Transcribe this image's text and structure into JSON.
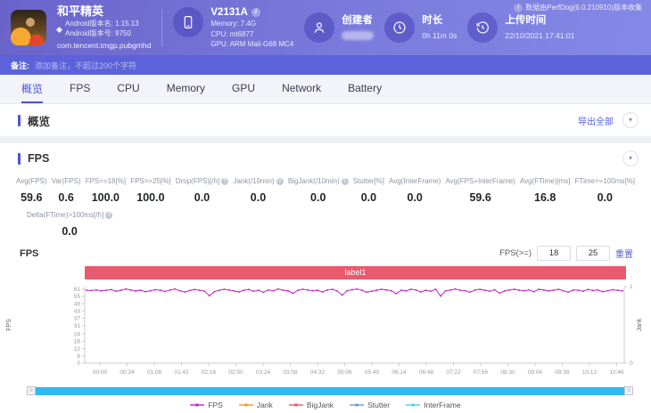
{
  "header": {
    "app": {
      "name": "和平精英",
      "version_name": "Android版本名: 1.15.13",
      "version_code": "Android版本号: 9750",
      "package": "com.tencent.tmgp.pubgmhd"
    },
    "device": {
      "model": "V2131A",
      "memory": "Memory: 7.4G",
      "cpu": "CPU: mt6877",
      "gpu": "GPU: ARM Mali-G68 MC4"
    },
    "creator": {
      "label": "创建者"
    },
    "duration": {
      "label": "时长",
      "value": "0h 11m 0s"
    },
    "upload": {
      "label": "上传时间",
      "value": "22/10/2021 17:41:01"
    },
    "collected_by": "数据由PerfDog(6.0.210910)版本收集"
  },
  "note_bar": {
    "label": "备注:",
    "placeholder": "添加备注，不超过200个字符"
  },
  "tabs": [
    {
      "label": "概览",
      "key": "overview"
    },
    {
      "label": "FPS",
      "key": "fps"
    },
    {
      "label": "CPU",
      "key": "cpu"
    },
    {
      "label": "Memory",
      "key": "memory"
    },
    {
      "label": "GPU",
      "key": "gpu"
    },
    {
      "label": "Network",
      "key": "network"
    },
    {
      "label": "Battery",
      "key": "battery"
    }
  ],
  "active_tab": "概览",
  "overview": {
    "title": "概览",
    "export_all": "导出全部"
  },
  "fps_section": {
    "title": "FPS",
    "stats": [
      {
        "label": "Avg(FPS)",
        "value": "59.6",
        "info": false
      },
      {
        "label": "Var(FPS)",
        "value": "0.6",
        "info": false
      },
      {
        "label": "FPS>=18[%]",
        "value": "100.0",
        "info": false
      },
      {
        "label": "FPS>=25[%]",
        "value": "100.0",
        "info": false
      },
      {
        "label": "Drop(FPS)[/h]",
        "value": "0.0",
        "info": true
      },
      {
        "label": "Jank(/10min)",
        "value": "0.0",
        "info": true
      },
      {
        "label": "BigJank(/10min)",
        "value": "0.0",
        "info": true
      },
      {
        "label": "Stutter[%]",
        "value": "0.0",
        "info": false
      },
      {
        "label": "Avg(InterFrame)",
        "value": "0.0",
        "info": false
      },
      {
        "label": "Avg(FPS+InterFrame)",
        "value": "59.6",
        "info": false
      },
      {
        "label": "Avg(FTime)[ms]",
        "value": "16.8",
        "info": false
      },
      {
        "label": "FTime>=100ms[%]",
        "value": "0.0",
        "info": false
      }
    ],
    "stats_row2": [
      {
        "label": "Delta(FTime)>100ms[/h]",
        "value": "0.0",
        "info": true
      }
    ],
    "chart_title": "FPS",
    "fps_threshold": {
      "label": "FPS(>=)",
      "low": "18",
      "high": "25",
      "reset": "重置"
    },
    "banner_label": "label1"
  },
  "chart_data": {
    "type": "line",
    "title": "FPS",
    "ylabel": "FPS",
    "y2label": "Jank",
    "ylim": [
      0,
      63
    ],
    "y2lim": [
      0,
      1
    ],
    "yticks": [
      61,
      55,
      49,
      43,
      37,
      31,
      24,
      18,
      12,
      6,
      0
    ],
    "y2ticks": [
      1,
      0
    ],
    "xticks": [
      "00:00",
      "00:34",
      "01:08",
      "01:42",
      "02:16",
      "02:50",
      "03:24",
      "03:58",
      "04:32",
      "05:06",
      "05:40",
      "06:14",
      "06:48",
      "07:22",
      "07:56",
      "08:30",
      "09:04",
      "09:38",
      "10:12",
      "10:46"
    ],
    "grid": false,
    "legend_position": "bottom",
    "series": [
      {
        "name": "FPS",
        "color": "#c522c9",
        "values": [
          60,
          59.8,
          60.2,
          59.5,
          60,
          60.5,
          59.2,
          60,
          61,
          60.2,
          59.4,
          60,
          58.8,
          59.6,
          60.4,
          60,
          59,
          60.2,
          61,
          59.6,
          58.5,
          59.8,
          60.6,
          60,
          59.2,
          55.5,
          58.8,
          60,
          60.8,
          60.2,
          59.4,
          58.6,
          60,
          60.6,
          59.2,
          60,
          58.4,
          60.2,
          59.6,
          61,
          60,
          59.4,
          57.5,
          60,
          60.8,
          60.2,
          59.6,
          60,
          58.6,
          60.2,
          60.8,
          59.4,
          56,
          59.6,
          60.4,
          61,
          60,
          58.4,
          59.2,
          60,
          60.8,
          60.2,
          59.6,
          57.2,
          60,
          59.4,
          60.8,
          60.2,
          58.6,
          60,
          59.2,
          60.8,
          55.2,
          59.4,
          60.2,
          61,
          60,
          59.6,
          58.4,
          60.2,
          60.8,
          60,
          59.2,
          60.4,
          57.6,
          59.4,
          60.2,
          60.8,
          60,
          59.6,
          60.2,
          58.8,
          60.8,
          60.2,
          59.4,
          60,
          60.8,
          59.6,
          58.4,
          60.2,
          60,
          59.2,
          60.6,
          59.8,
          60.2,
          58.8,
          59.6,
          60.4,
          60,
          59.4
        ]
      },
      {
        "name": "Jank",
        "color": "#f59a23",
        "values": []
      },
      {
        "name": "BigJank",
        "color": "#e8556d",
        "values": []
      },
      {
        "name": "Stutter",
        "color": "#6b9bd2",
        "values": []
      },
      {
        "name": "InterFrame",
        "color": "#53c9e8",
        "values": []
      }
    ]
  }
}
